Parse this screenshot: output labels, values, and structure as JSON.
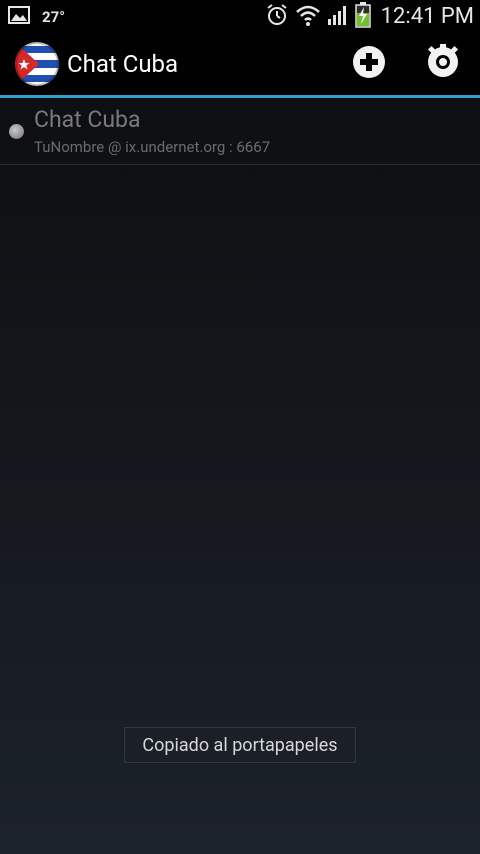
{
  "statusbar": {
    "temperature": "27°",
    "time": "12:41 PM",
    "icons": [
      "gallery-notification-icon",
      "alarm-icon",
      "wifi-icon",
      "signal-icon",
      "battery-charging-icon"
    ]
  },
  "actionbar": {
    "title": "Chat Cuba",
    "app_icon": "cuba-flag-icon",
    "actions": [
      "add-icon",
      "settings-icon"
    ],
    "divider_color": "#2fa1d0"
  },
  "servers": [
    {
      "name": "Chat Cuba",
      "details": "TuNombre @ ix.undernet.org : 6667",
      "status": "disconnected"
    }
  ],
  "toast": {
    "message": "Copiado al portapapeles"
  }
}
